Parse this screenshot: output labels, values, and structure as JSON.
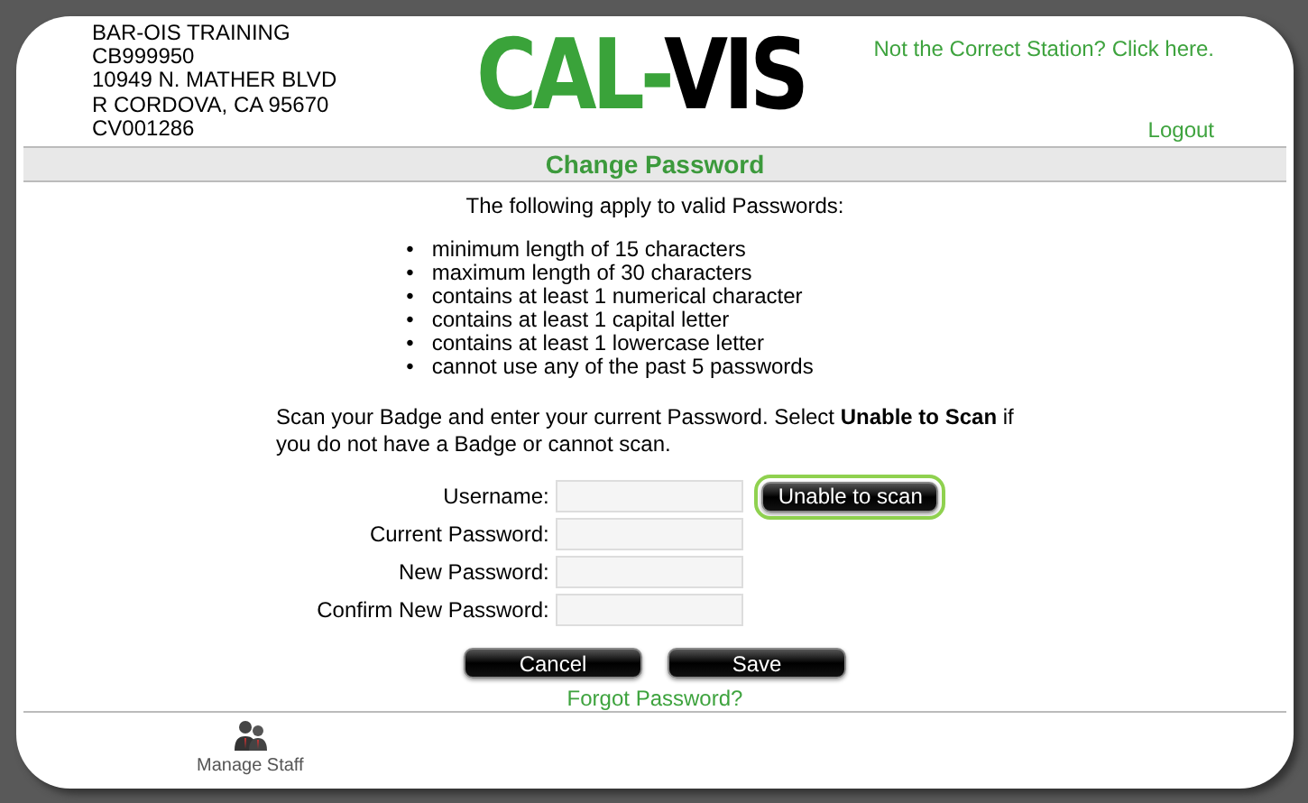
{
  "station": {
    "lines": [
      "BAR-OIS TRAINING",
      "CB999950",
      "10949 N. MATHER BLVD",
      "R CORDOVA, CA 95670",
      "CV001286"
    ]
  },
  "logo": {
    "left": "CAL",
    "dash": "-",
    "right": "VIS"
  },
  "header_links": {
    "station_link": "Not the Correct Station? Click here.",
    "logout": "Logout"
  },
  "page_title": "Change Password",
  "rules": {
    "intro": "The following apply to valid Passwords:",
    "marker": "•",
    "items": [
      "minimum length of 15 characters",
      "maximum length of 30 characters",
      "contains at least 1 numerical character",
      "contains at least 1 capital letter",
      "contains at least 1 lowercase letter",
      "cannot use any of the past 5 passwords"
    ]
  },
  "instructions": "Scan your Badge and enter your current Password. Select **Unable to Scan** if you do not have a Badge or cannot scan.",
  "fields": [
    {
      "label": "Username:"
    },
    {
      "label": "Current Password:"
    },
    {
      "label": "New Password:"
    },
    {
      "label": "Confirm New Password:"
    }
  ],
  "scan_button": {
    "label": "Unable to scan",
    "focused": true
  },
  "buttons": [
    "Cancel",
    "Save"
  ],
  "forgot_link": "Forgot Password?",
  "footer": {
    "items": [
      {
        "label": "Manage Staff"
      }
    ]
  }
}
